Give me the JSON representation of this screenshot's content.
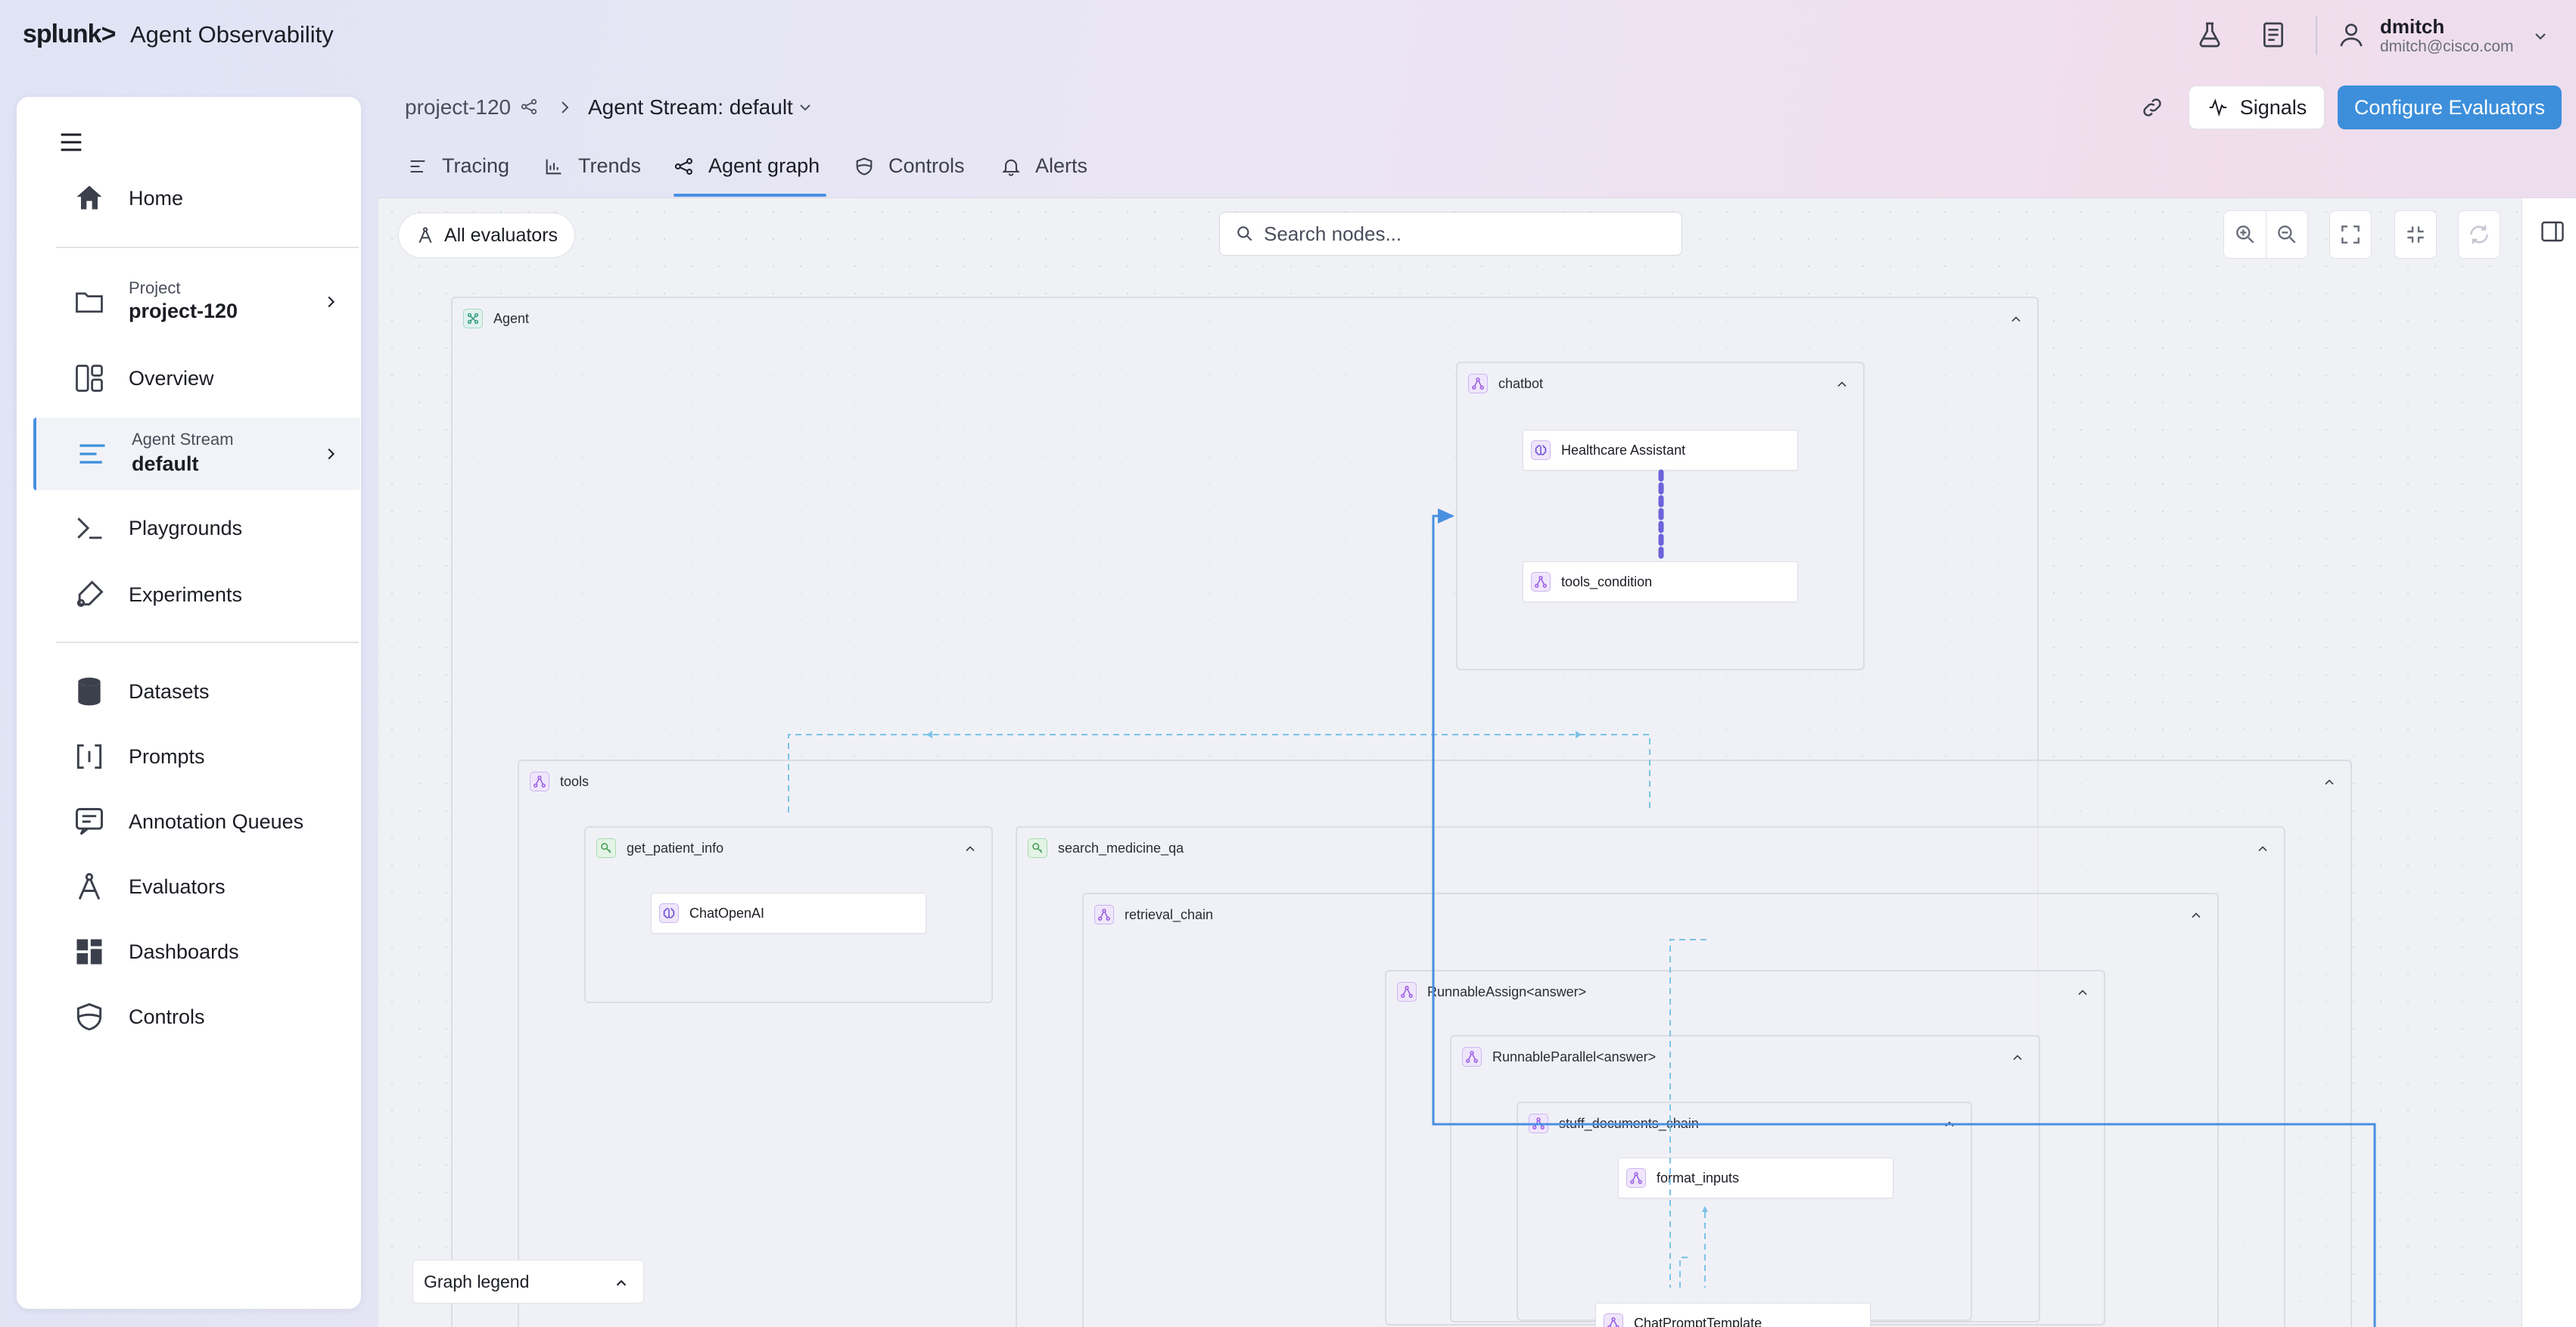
{
  "app": {
    "logo": "splunk>",
    "title": "Agent Observability"
  },
  "user": {
    "name": "dmitch",
    "email": "dmitch@cisco.com"
  },
  "sidebar": {
    "home": "Home",
    "project_label": "Project",
    "project_value": "project-120",
    "overview": "Overview",
    "stream_label": "Agent Stream",
    "stream_value": "default",
    "playgrounds": "Playgrounds",
    "experiments": "Experiments",
    "datasets": "Datasets",
    "prompts": "Prompts",
    "annotation_queues": "Annotation Queues",
    "evaluators": "Evaluators",
    "dashboards": "Dashboards",
    "controls": "Controls"
  },
  "breadcrumb": {
    "project": "project-120",
    "stream": "Agent Stream: default"
  },
  "tabs": [
    {
      "label": "Tracing",
      "icon": "list-icon"
    },
    {
      "label": "Trends",
      "icon": "bar-chart-icon"
    },
    {
      "label": "Agent graph",
      "icon": "graph-icon",
      "active": true
    },
    {
      "label": "Controls",
      "icon": "shield-icon"
    },
    {
      "label": "Alerts",
      "icon": "bell-icon"
    }
  ],
  "actions": {
    "signals": "Signals",
    "configure": "Configure Evaluators"
  },
  "toolbar": {
    "all_evaluators": "All evaluators",
    "search_placeholder": "Search nodes..."
  },
  "graph": {
    "agent": "Agent",
    "chatbot": "chatbot",
    "healthcare_assistant": "Healthcare Assistant",
    "tools_condition": "tools_condition",
    "tools": "tools",
    "get_patient_info": "get_patient_info",
    "chat_openai": "ChatOpenAI",
    "search_medicine_qa": "search_medicine_qa",
    "retrieval_chain": "retrieval_chain",
    "runnable_assign": "RunnableAssign<answer>",
    "runnable_parallel": "RunnableParallel<answer>",
    "stuff_documents_chain": "stuff_documents_chain",
    "format_inputs": "format_inputs",
    "chat_prompt_template": "ChatPromptTemplate"
  },
  "legend": {
    "label": "Graph legend"
  },
  "colors": {
    "accent": "#3d8fdb",
    "edge_solid": "#4a90e2",
    "edge_dotted": "#6c63d9",
    "edge_dashed": "#7cc3ea"
  }
}
